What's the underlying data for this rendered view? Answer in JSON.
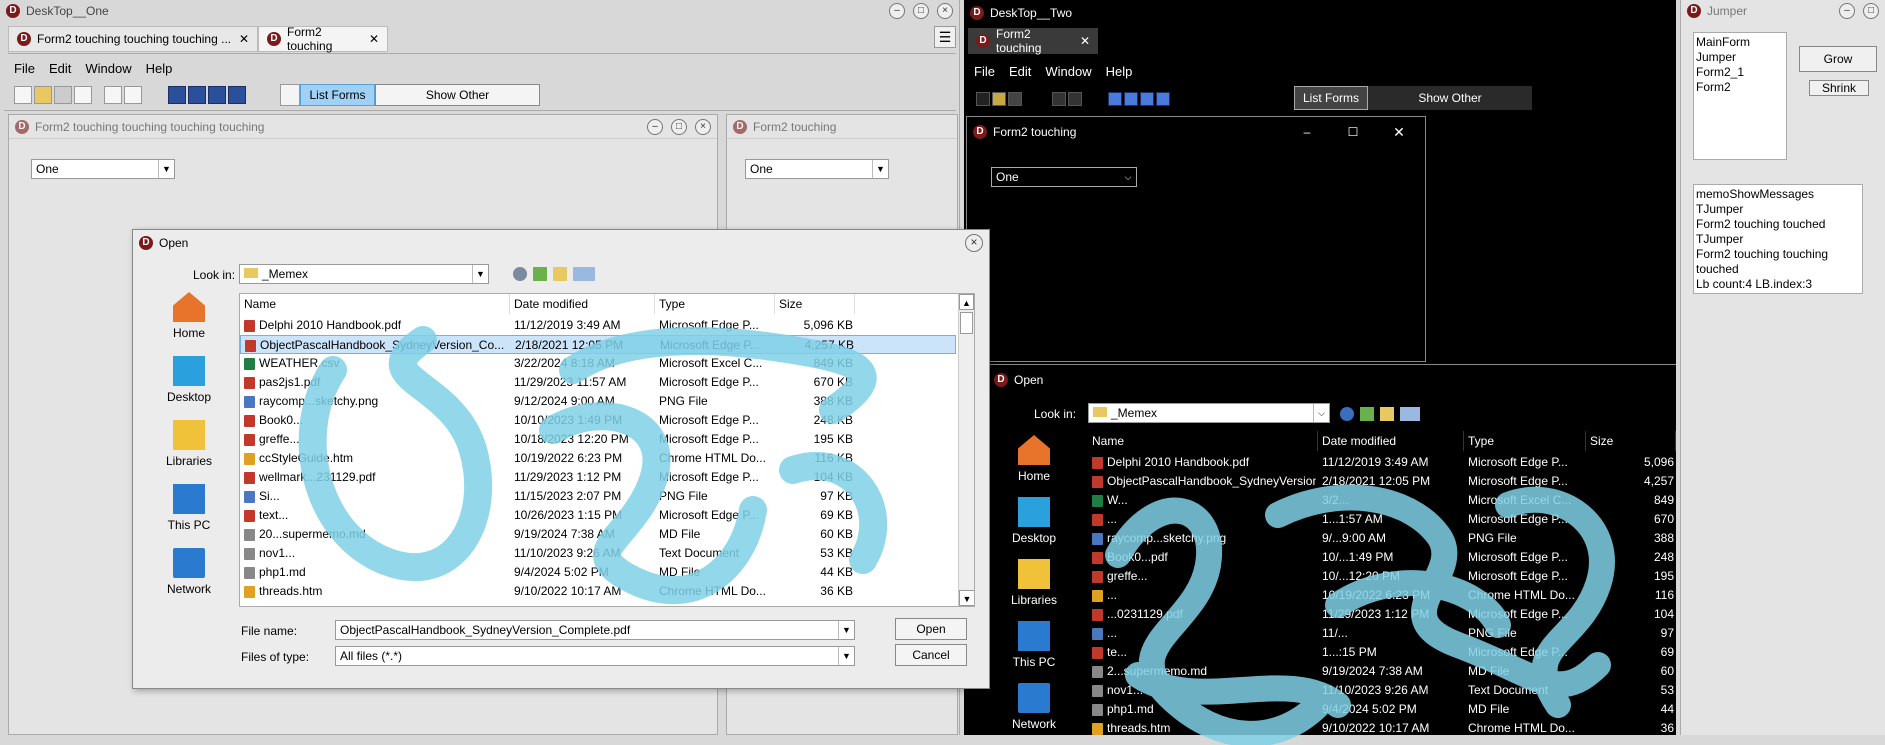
{
  "desktop_one": {
    "title": "DeskTop__One",
    "tabs": [
      {
        "label": "Form2 touching touching touching ..."
      },
      {
        "label": "Form2 touching"
      }
    ],
    "menu": [
      "File",
      "Edit",
      "Window",
      "Help"
    ],
    "list_forms_label": "List Forms",
    "show_other_label": "Show Other",
    "child1": {
      "title": "Form2 touching touching touching touching",
      "combo": "One"
    },
    "child2": {
      "title": "Form2 touching",
      "combo": "One"
    }
  },
  "desktop_two": {
    "title": "DeskTop__Two",
    "tab": "Form2 touching",
    "menu": [
      "File",
      "Edit",
      "Window",
      "Help"
    ],
    "list_forms_label": "List Forms",
    "show_other_label": "Show Other",
    "child": {
      "title": "Form2 touching",
      "combo": "One"
    }
  },
  "jumper": {
    "title": "Jumper",
    "list": [
      "MainForm",
      "Jumper",
      "Form2_1",
      "Form2"
    ],
    "grow_label": "Grow",
    "shrink_label": "Shrink",
    "memo": [
      "memoShowMessages",
      "TJumper",
      "Form2 touching touched",
      "TJumper",
      "Form2 touching touching",
      "touched",
      "Lb count:4 LB.index:3"
    ]
  },
  "open_dialog_light": {
    "title": "Open",
    "look_in_label": "Look in:",
    "look_in_value": "_Memex",
    "places": [
      "Home",
      "Desktop",
      "Libraries",
      "This PC",
      "Network"
    ],
    "columns": [
      "Name",
      "Date modified",
      "Type",
      "Size"
    ],
    "files": [
      {
        "name": "Delphi 2010 Handbook.pdf",
        "date": "11/12/2019 3:49 AM",
        "type": "Microsoft Edge P...",
        "size": "5,096 KB",
        "icon": "pdf"
      },
      {
        "name": "ObjectPascalHandbook_SydneyVersion_Co...",
        "date": "2/18/2021 12:05 PM",
        "type": "Microsoft Edge P...",
        "size": "4,257 KB",
        "icon": "pdf"
      },
      {
        "name": "WEATHER.csv",
        "date": "3/22/2024 8:18 AM",
        "type": "Microsoft Excel C...",
        "size": "849 KB",
        "icon": "xls"
      },
      {
        "name": "pas2js1.pdf",
        "date": "11/29/2023 11:57 AM",
        "type": "Microsoft Edge P...",
        "size": "670 KB",
        "icon": "pdf"
      },
      {
        "name": "raycomp...sketchy.png",
        "date": "9/12/2024 9:00 AM",
        "type": "PNG File",
        "size": "388 KB",
        "icon": "png"
      },
      {
        "name": "Book0...",
        "date": "10/10/2023 1:49 PM",
        "type": "Microsoft Edge P...",
        "size": "248 KB",
        "icon": "pdf"
      },
      {
        "name": "greffe...",
        "date": "10/18/2023 12:20 PM",
        "type": "Microsoft Edge P...",
        "size": "195 KB",
        "icon": "pdf"
      },
      {
        "name": "ccStyleGuide.htm",
        "date": "10/19/2022 6:23 PM",
        "type": "Chrome HTML Do...",
        "size": "116 KB",
        "icon": "htm"
      },
      {
        "name": "wellmark...231129.pdf",
        "date": "11/29/2023 1:12 PM",
        "type": "Microsoft Edge P...",
        "size": "104 KB",
        "icon": "pdf"
      },
      {
        "name": "Si...",
        "date": "11/15/2023 2:07 PM",
        "type": "PNG File",
        "size": "97 KB",
        "icon": "png"
      },
      {
        "name": "text...",
        "date": "10/26/2023 1:15 PM",
        "type": "Microsoft Edge P...",
        "size": "69 KB",
        "icon": "pdf"
      },
      {
        "name": "20...supermemo.md",
        "date": "9/19/2024 7:38 AM",
        "type": "MD File",
        "size": "60 KB",
        "icon": "txt"
      },
      {
        "name": "nov1...",
        "date": "11/10/2023 9:26 AM",
        "type": "Text Document",
        "size": "53 KB",
        "icon": "txt"
      },
      {
        "name": "php1.md",
        "date": "9/4/2024 5:02 PM",
        "type": "MD File",
        "size": "44 KB",
        "icon": "txt"
      },
      {
        "name": "threads.htm",
        "date": "9/10/2022 10:17 AM",
        "type": "Chrome HTML Do...",
        "size": "36 KB",
        "icon": "htm"
      }
    ],
    "file_name_label": "File name:",
    "file_name_value": "ObjectPascalHandbook_SydneyVersion_Complete.pdf",
    "file_type_label": "Files of type:",
    "file_type_value": "All files (*.*)",
    "open_label": "Open",
    "cancel_label": "Cancel"
  },
  "open_dialog_dark": {
    "title": "Open",
    "look_in_label": "Look in:",
    "look_in_value": "_Memex",
    "places": [
      "Home",
      "Desktop",
      "Libraries",
      "This PC",
      "Network"
    ],
    "columns": [
      "Name",
      "Date modified",
      "Type",
      "Size"
    ],
    "files": [
      {
        "name": "Delphi 2010 Handbook.pdf",
        "date": "11/12/2019 3:49 AM",
        "type": "Microsoft Edge P...",
        "size": "5,096",
        "icon": "pdf"
      },
      {
        "name": "ObjectPascalHandbook_SydneyVersion_Co...",
        "date": "2/18/2021 12:05 PM",
        "type": "Microsoft Edge P...",
        "size": "4,257",
        "icon": "pdf"
      },
      {
        "name": "W...",
        "date": "3/2...",
        "type": "Microsoft Excel C...",
        "size": "849",
        "icon": "xls"
      },
      {
        "name": "...",
        "date": "1...1:57 AM",
        "type": "Microsoft Edge P...",
        "size": "670",
        "icon": "pdf"
      },
      {
        "name": "raycomp...sketchy.png",
        "date": "9/...9:00 AM",
        "type": "PNG File",
        "size": "388",
        "icon": "png"
      },
      {
        "name": "Book0...pdf",
        "date": "10/...1:49 PM",
        "type": "Microsoft Edge P...",
        "size": "248",
        "icon": "pdf"
      },
      {
        "name": "greffe...",
        "date": "10/...12:20 PM",
        "type": "Microsoft Edge P...",
        "size": "195",
        "icon": "pdf"
      },
      {
        "name": "...",
        "date": "10/19/2022 6:23 PM",
        "type": "Chrome HTML Do...",
        "size": "116",
        "icon": "htm"
      },
      {
        "name": "...0231129.pdf",
        "date": "11/29/2023 1:12 PM",
        "type": "Microsoft Edge P...",
        "size": "104",
        "icon": "pdf"
      },
      {
        "name": "...",
        "date": "11/...",
        "type": "PNG File",
        "size": "97",
        "icon": "png"
      },
      {
        "name": "te...",
        "date": "1...:15 PM",
        "type": "Microsoft Edge P...",
        "size": "69",
        "icon": "pdf"
      },
      {
        "name": "2...supermemo.md",
        "date": "9/19/2024 7:38 AM",
        "type": "MD File",
        "size": "60",
        "icon": "txt"
      },
      {
        "name": "nov1...",
        "date": "11/10/2023 9:26 AM",
        "type": "Text Document",
        "size": "53",
        "icon": "txt"
      },
      {
        "name": "php1.md",
        "date": "9/4/2024 5:02 PM",
        "type": "MD File",
        "size": "44",
        "icon": "txt"
      },
      {
        "name": "threads.htm",
        "date": "9/10/2022 10:17 AM",
        "type": "Chrome HTML Do...",
        "size": "36",
        "icon": "htm"
      }
    ]
  },
  "colors": {
    "accent": "#1f6fd6",
    "scribble": "#7fd0e6",
    "dark_bg": "#000000",
    "list_forms_bg": "#9fd0f5"
  }
}
